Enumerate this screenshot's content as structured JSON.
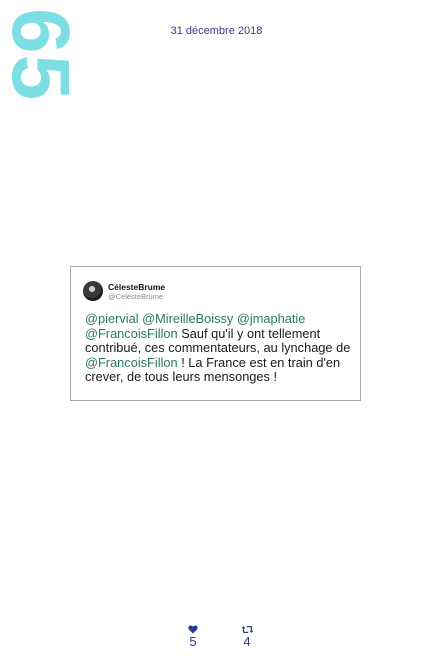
{
  "page_number": "65",
  "date": "31 décembre 2018",
  "tweet": {
    "display_name": "CélesteBrume",
    "handle": "@CelesteBrume",
    "body": [
      {
        "type": "mention",
        "text": "@piervial"
      },
      {
        "type": "text",
        "text": " "
      },
      {
        "type": "mention",
        "text": "@MireilleBoissy"
      },
      {
        "type": "text",
        "text": " "
      },
      {
        "type": "mention",
        "text": "@jmaphatie"
      },
      {
        "type": "text",
        "text": " "
      },
      {
        "type": "mention",
        "text": "@FrancoisFillon"
      },
      {
        "type": "text",
        "text": " Sauf qu'il y ont tellement contribué, ces commentateurs, au lynchage de "
      },
      {
        "type": "mention",
        "text": "@FrancoisFillon"
      },
      {
        "type": "text",
        "text": " ! La France est en train d'en crever, de tous leurs mensonges !"
      }
    ]
  },
  "stats": {
    "likes": "5",
    "retweets": "4"
  },
  "icons": {
    "like": "heart-icon",
    "retweet": "retweet-icon"
  },
  "colors": {
    "page_number": "#7ddfe3",
    "date": "#3a3a8c",
    "mention": "#2a7a5a",
    "stats": "#2a3a8c"
  }
}
